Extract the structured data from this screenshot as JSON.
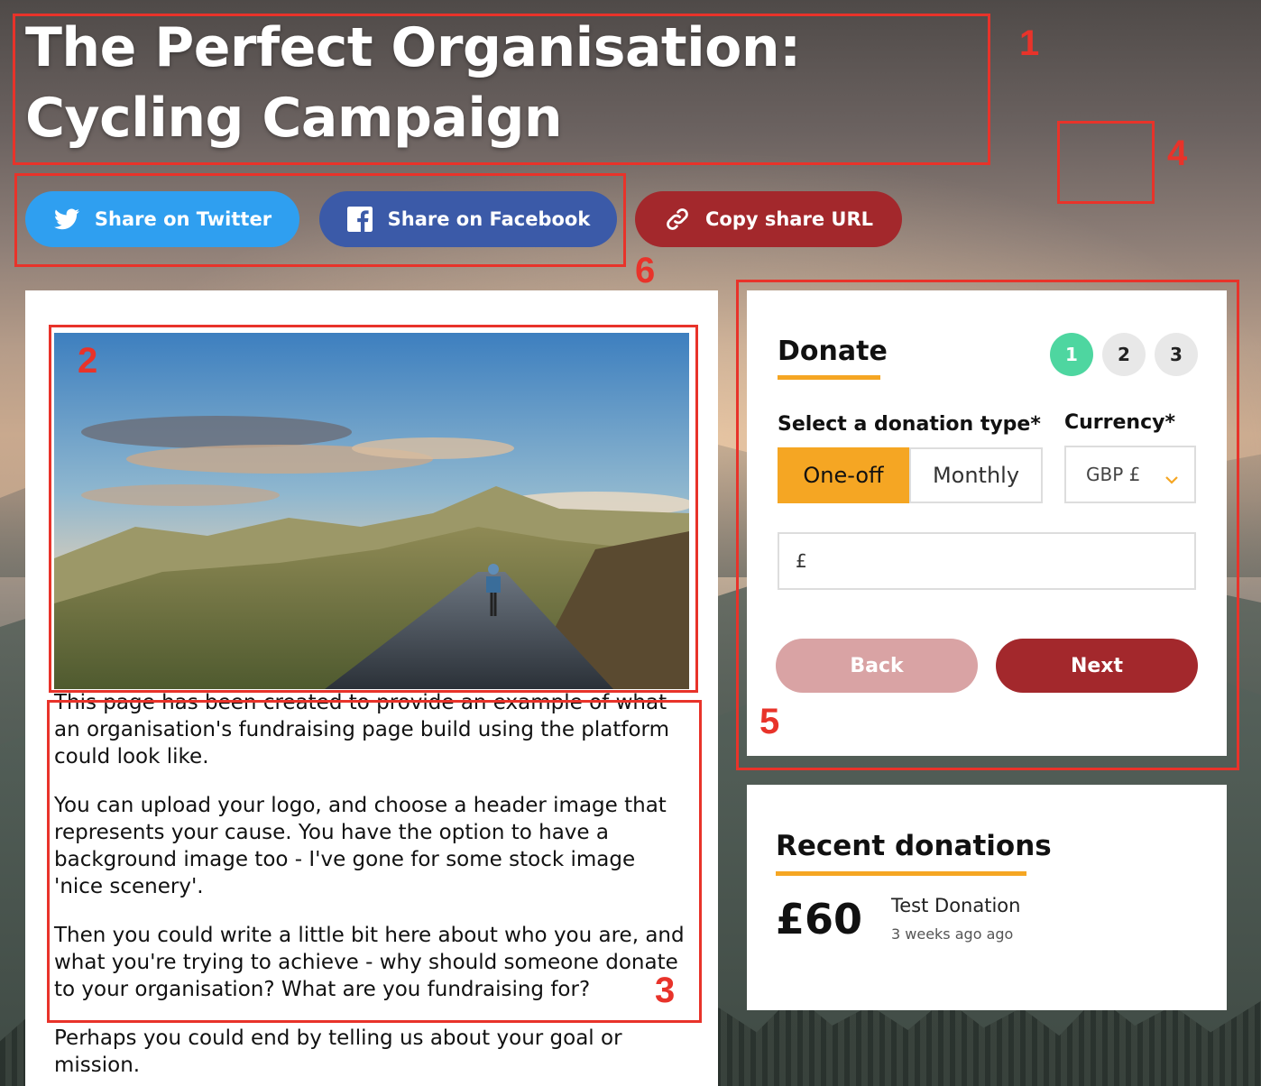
{
  "page": {
    "title": "The Perfect Organisation: Cycling Campaign"
  },
  "share": {
    "twitter_label": "Share on Twitter",
    "facebook_label": "Share on Facebook",
    "copy_label": "Copy share URL",
    "colors": {
      "twitter": "#2f9ff0",
      "facebook": "#3b5aa8",
      "copy": "#a3282c"
    }
  },
  "content": {
    "hero_image": "cyclist-on-mountain-road",
    "paragraphs": [
      "This page has been created to provide an example of what an organisation's fundraising page build using the platform could look like.",
      "You can upload your logo, and choose a header image that represents your cause. You have the option to have a background image too - I've gone for some stock image 'nice scenery'.",
      "Then you could write a little bit here about who you are, and what you're trying to achieve - why should someone donate to your organisation? What are you fundraising for?",
      "Perhaps you could end by telling us about your goal or mission."
    ]
  },
  "donate": {
    "title": "Donate",
    "steps": [
      "1",
      "2",
      "3"
    ],
    "active_step": "1",
    "donation_type_label": "Select a donation type*",
    "currency_label": "Currency*",
    "type_options": [
      "One-off",
      "Monthly"
    ],
    "selected_type": "One-off",
    "currency_value": "GBP £",
    "amount_prefix": "£",
    "back_label": "Back",
    "next_label": "Next",
    "colors": {
      "accent": "#f5a623",
      "step_active": "#4ed6a0",
      "next": "#a3282c",
      "back": "#d9a3a4"
    }
  },
  "recent": {
    "title": "Recent donations",
    "items": [
      {
        "amount": "£60",
        "name": "Test Donation",
        "time": "3 weeks ago ago"
      }
    ]
  },
  "annotations": [
    "1",
    "2",
    "3",
    "4",
    "5",
    "6"
  ]
}
